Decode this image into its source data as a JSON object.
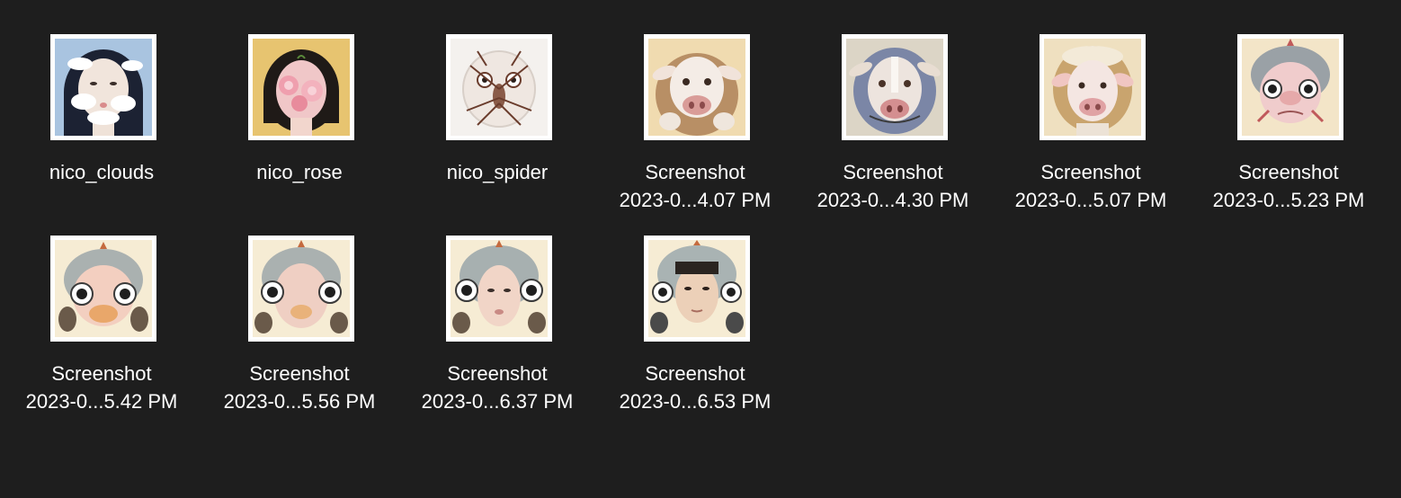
{
  "files": [
    {
      "line1": "nico_clouds",
      "line2": "",
      "thumb_icon": "girl-clouds-portrait-icon",
      "bg": "#a9c4e0",
      "face": "#f1e5dc",
      "hair": "#1c2233",
      "accent": "#ffffff"
    },
    {
      "line1": "nico_rose",
      "line2": "",
      "thumb_icon": "girl-rose-portrait-icon",
      "bg": "#e7c470",
      "face": "#f0c7c8",
      "hair": "#1f1a17",
      "accent": "#e99aa7"
    },
    {
      "line1": "nico_spider",
      "line2": "",
      "thumb_icon": "spider-face-portrait-icon",
      "bg": "#f4f1ee",
      "face": "#efe7e1",
      "hair": "#8a5b48",
      "accent": "#6a3c2c"
    },
    {
      "line1": "Screenshot",
      "line2": "2023-0...4.07 PM",
      "thumb_icon": "cow-portrait-icon",
      "bg": "#f0dbb0",
      "face": "#f4ece6",
      "hair": "#b88f65",
      "accent": "#d99c98"
    },
    {
      "line1": "Screenshot",
      "line2": "2023-0...4.30 PM",
      "thumb_icon": "cow-portrait-icon",
      "bg": "#dcd5c6",
      "face": "#ede4de",
      "hair": "#7b86a6",
      "accent": "#d48f90"
    },
    {
      "line1": "Screenshot",
      "line2": "2023-0...5.07 PM",
      "thumb_icon": "cow-portrait-icon",
      "bg": "#efe0c0",
      "face": "#f4e6e2",
      "hair": "#c9a46e",
      "accent": "#e0a2a4"
    },
    {
      "line1": "Screenshot",
      "line2": "2023-0...5.23 PM",
      "thumb_icon": "pig-creature-portrait-icon",
      "bg": "#f3e5c8",
      "face": "#f0cccc",
      "hair": "#9aa1a6",
      "accent": "#c05a5a"
    },
    {
      "line1": "Screenshot",
      "line2": "2023-0...5.42 PM",
      "thumb_icon": "fish-creature-portrait-icon",
      "bg": "#f6ecd4",
      "face": "#f3cfc0",
      "hair": "#aab1b0",
      "accent": "#c56a3e"
    },
    {
      "line1": "Screenshot",
      "line2": "2023-0...5.56 PM",
      "thumb_icon": "fish-creature-portrait-icon",
      "bg": "#f6ecd4",
      "face": "#efcfc3",
      "hair": "#aab1b0",
      "accent": "#c56a3e"
    },
    {
      "line1": "Screenshot",
      "line2": "2023-0...6.37 PM",
      "thumb_icon": "fish-creature-portrait-icon",
      "bg": "#f6ecd4",
      "face": "#f1d5c7",
      "hair": "#a7b0b0",
      "accent": "#c56a3e"
    },
    {
      "line1": "Screenshot",
      "line2": "2023-0...6.53 PM",
      "thumb_icon": "man-portrait-icon",
      "bg": "#f6ecd4",
      "face": "#ecd0b8",
      "hair": "#a9b3b3",
      "accent": "#c56a3e"
    }
  ]
}
